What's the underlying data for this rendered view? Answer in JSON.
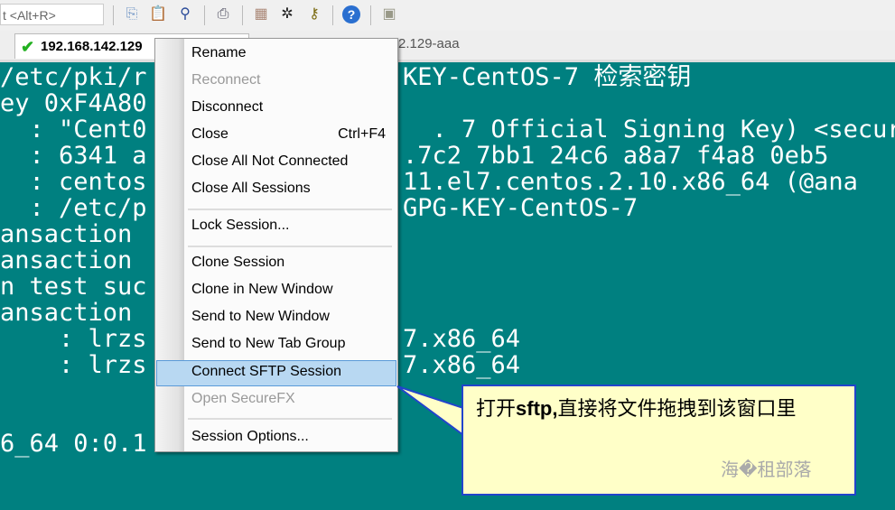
{
  "toolbar": {
    "command_hint": "t <Alt+R>",
    "icons": [
      "copy-icon",
      "paste-icon",
      "find-icon",
      "print-icon",
      "session-options-icon",
      "keymap-icon",
      "key-icon",
      "help-icon",
      "securefx-icon"
    ]
  },
  "tabs": [
    {
      "label": "192.168.142.129",
      "status": "connected",
      "status_color": "#22b020"
    },
    {
      "label": "2.129-aaa"
    }
  ],
  "terminal": {
    "background": "#008080",
    "lines": [
      {
        "left": "/etc/pki/r",
        "right": "KEY-CentOS-7 检索密钥"
      },
      {
        "left": "ey 0xF4A80",
        "right": ""
      },
      {
        "left": "  : \"Cent0",
        "right": "  . 7 Official Signing Key) <secur"
      },
      {
        "left": "  : 6341 a",
        "right": ".7c2 7bb1 24c6 a8a7 f4a8 0eb5"
      },
      {
        "left": "  : centos",
        "right": "11.el7.centos.2.10.x86_64 (@ana"
      },
      {
        "left": "  : /etc/p",
        "right": "GPG-KEY-CentOS-7"
      },
      {
        "left": "ansaction ",
        "right": ""
      },
      {
        "left": "ansaction ",
        "right": ""
      },
      {
        "left": "n test suc",
        "right": ""
      },
      {
        "left": "ansaction ",
        "right": ""
      },
      {
        "left": "    : lrzs",
        "right": "7.x86_64"
      },
      {
        "left": "    : lrzs",
        "right": "7.x86_64"
      },
      {
        "left": "",
        "right": ""
      },
      {
        "left": "",
        "right": ""
      },
      {
        "left": "6_64 0:0.1",
        "right": ""
      }
    ]
  },
  "context_menu": {
    "items": [
      {
        "label": "Rename"
      },
      {
        "label": "Reconnect",
        "disabled": true
      },
      {
        "label": "Disconnect"
      },
      {
        "label": "Close",
        "shortcut": "Ctrl+F4"
      },
      {
        "label": "Close All Not Connected"
      },
      {
        "label": "Close All Sessions"
      },
      {
        "label": "Lock Session..."
      },
      {
        "label": "Clone Session"
      },
      {
        "label": "Clone in New Window"
      },
      {
        "label": "Send to New Window"
      },
      {
        "label": "Send to New Tab Group"
      },
      {
        "label": "Connect SFTP Session",
        "highlighted": true
      },
      {
        "label": "Open SecureFX",
        "disabled": true
      },
      {
        "label": "Session Options..."
      }
    ]
  },
  "callout": {
    "text_prefix": "打开",
    "text_bold": "sftp,",
    "text_suffix": "直接将文件拖拽到该窗口里",
    "watermark": "海�租部落"
  }
}
